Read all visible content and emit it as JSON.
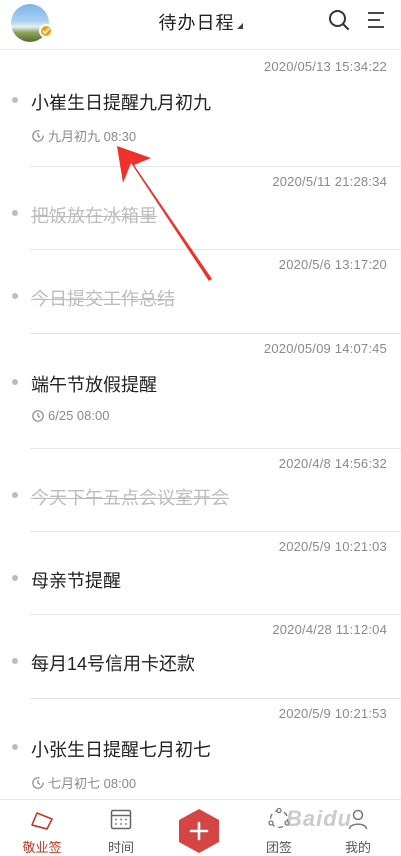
{
  "header": {
    "title": "待办日程"
  },
  "items": [
    {
      "timestamp": "2020/05/13 15:34:22",
      "text": "小崔生日提醒九月初九",
      "done": false,
      "reminder": "九月初九 08:30",
      "reminder_type": "recurring-icon"
    },
    {
      "timestamp": "2020/5/11 21:28:34",
      "text": "把饭放在冰箱里",
      "done": true
    },
    {
      "timestamp": "2020/5/6 13:17:20",
      "text": "今日提交工作总结",
      "done": true
    },
    {
      "timestamp": "2020/05/09 14:07:45",
      "text": "端午节放假提醒",
      "done": false,
      "reminder": "6/25 08:00",
      "reminder_type": "clock-icon"
    },
    {
      "timestamp": "2020/4/8 14:56:32",
      "text": "今天下午五点会议室开会",
      "done": true
    },
    {
      "timestamp": "2020/5/9 10:21:03",
      "text": "母亲节提醒",
      "done": false
    },
    {
      "timestamp": "2020/4/28 11:12:04",
      "text": "每月14号信用卡还款",
      "done": false
    },
    {
      "timestamp": "2020/5/9 10:21:53",
      "text": "小张生日提醒七月初七",
      "done": false,
      "reminder": "七月初七 08:00",
      "reminder_type": "recurring-icon"
    }
  ],
  "tabbar": {
    "tabs": [
      {
        "label": "敬业签",
        "icon": "notebook-icon",
        "active": true
      },
      {
        "label": "时间",
        "icon": "calendar-icon",
        "active": false
      },
      {
        "label": "团签",
        "icon": "team-icon",
        "active": false
      },
      {
        "label": "我的",
        "icon": "user-icon",
        "active": false
      }
    ],
    "add_icon": "plus-icon"
  },
  "watermark": "Baidu",
  "colors": {
    "accent": "#c0392b",
    "fab": "#d64545",
    "done_text": "#bcbcbc",
    "annotation_arrow": "#f0302a"
  }
}
